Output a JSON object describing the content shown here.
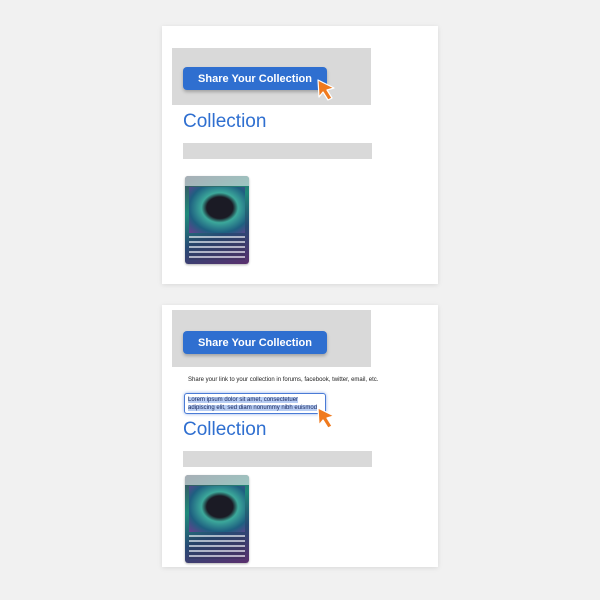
{
  "panels": [
    {
      "share_button_label": "Share Your Collection",
      "heading": "Collection"
    },
    {
      "share_button_label": "Share Your Collection",
      "description": "Share your link to your collection in forums, facebook, twitter, email, etc.",
      "link_text": "Lorem ipsum dolor sit amet, consectetuer adipiscing elit, sed diam nonummy nibh euismod tincidunt ut",
      "heading": "Collection"
    }
  ],
  "colors": {
    "accent": "#2f6fd0",
    "cursor": "#f07a1e",
    "placeholder_gray": "#d9d9d9"
  },
  "icons": {
    "cursor": "pointer-cursor-icon",
    "card": "trading-card-image"
  }
}
